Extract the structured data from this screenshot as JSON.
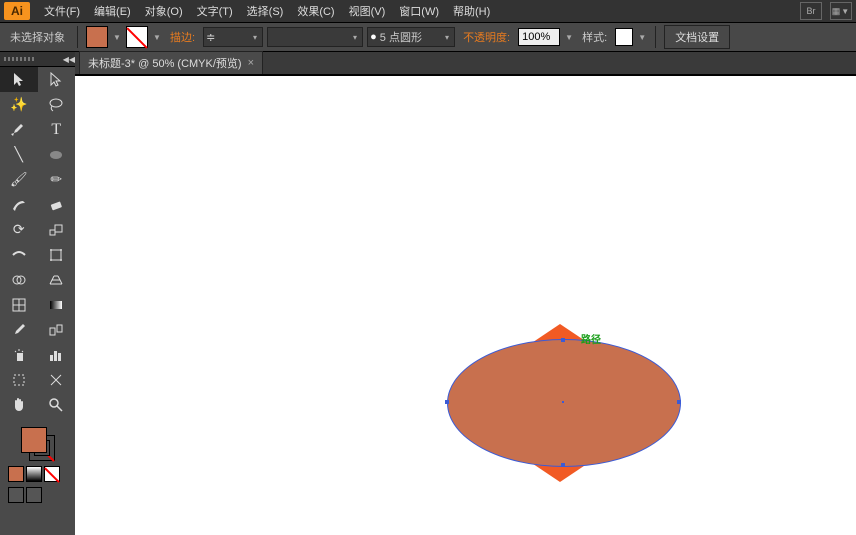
{
  "app": {
    "logo": "Ai"
  },
  "menu": {
    "items": [
      "文件(F)",
      "编辑(E)",
      "对象(O)",
      "文字(T)",
      "选择(S)",
      "效果(C)",
      "视图(V)",
      "窗口(W)",
      "帮助(H)"
    ],
    "br": "Br"
  },
  "ctrl": {
    "noSelection": "未选择对象",
    "fill": "#C8704E",
    "strokeLabel": "描边:",
    "strokeWeight": "",
    "brushWidth": "",
    "strokeProfile": "5 点圆形",
    "opacityLabel": "不透明度:",
    "opacityValue": "100%",
    "styleLabel": "样式:",
    "docSetup": "文档设置"
  },
  "tab": {
    "title": "未标题-3* @ 50% (CMYK/预览)"
  },
  "canvas": {
    "pathLabel": "路径"
  },
  "colors": {
    "fill": "#C8704E",
    "hex": "#f15a24"
  }
}
